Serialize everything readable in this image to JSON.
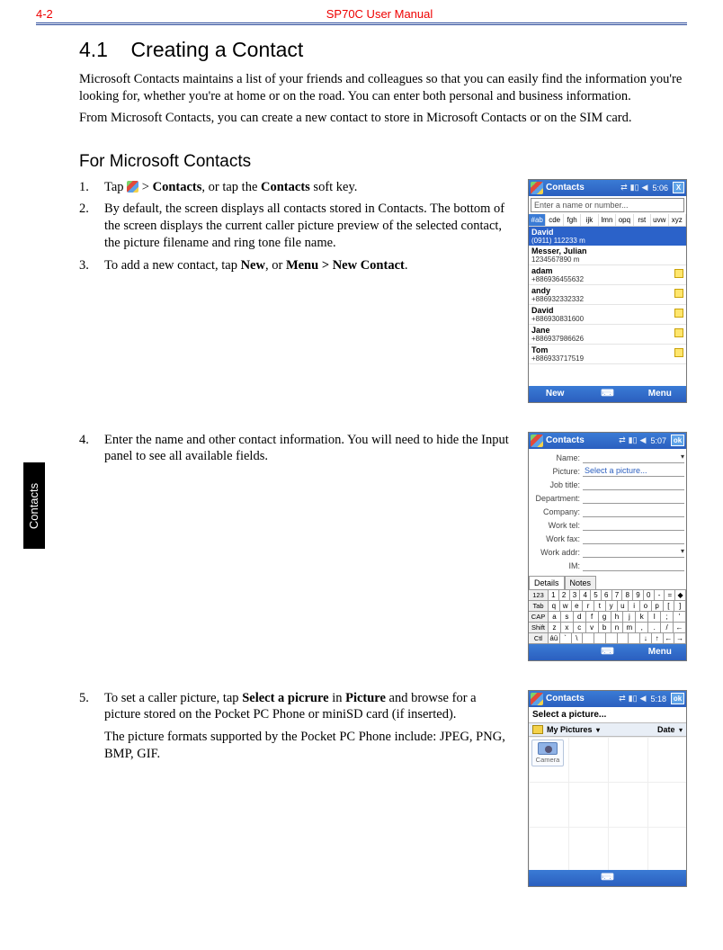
{
  "header": {
    "page_number": "4-2",
    "manual_title": "SP70C User Manual"
  },
  "side_tab": "Contacts",
  "section": {
    "number": "4.1",
    "title": "Creating a Contact"
  },
  "intro_paragraphs": [
    "Microsoft Contacts maintains a list of your friends and colleagues so that you can easily find the information you're looking for, whether you're at home or on the road. You can enter both personal and business information.",
    "From Microsoft Contacts, you can create a new contact to store in Microsoft Contacts or on the SIM card."
  ],
  "subsection_title": "For Microsoft Contacts",
  "steps": {
    "s1": {
      "num": "1.",
      "pre": "Tap ",
      "link": "Contacts",
      "mid": ", or tap the ",
      "link2": "Contacts",
      "post": " soft key.",
      "gt": " > "
    },
    "s2": {
      "num": "2.",
      "text": "By default, the screen displays all contacts stored in Contacts. The bottom of the screen displays the current caller picture preview of the selected contact, the picture filename and ring tone file name."
    },
    "s3": {
      "num": "3.",
      "pre": "To add a new contact, tap ",
      "b1": "New",
      "mid": ", or ",
      "b2": "Menu > New Contact",
      "post": "."
    },
    "s4": {
      "num": "4.",
      "text": "Enter the name and other contact information. You will need to hide the Input panel to see all available fields."
    },
    "s5": {
      "num": "5.",
      "pre": "To set a caller picture, tap ",
      "b1": "Select a picrure",
      "mid": " in ",
      "b2": "Picture",
      "post": " and browse for a picture stored on the Pocket PC Phone or miniSD card (if inserted).",
      "extra": "The picture formats supported by the Pocket PC Phone include: JPEG, PNG, BMP, GIF."
    }
  },
  "shot1": {
    "title": "Contacts",
    "clock": "5:06",
    "close": "X",
    "search_placeholder": "Enter a name or number...",
    "alpha": [
      "#ab",
      "cde",
      "fgh",
      "ijk",
      "lmn",
      "opq",
      "rst",
      "uvw",
      "xyz"
    ],
    "selected": {
      "name": "David",
      "detail": "(0911) 112233  m"
    },
    "rows": [
      {
        "name": "Messer, Julian",
        "detail": "1234567890  m",
        "sim": false
      },
      {
        "name": "adam",
        "detail": "+886936455632",
        "sim": true
      },
      {
        "name": "andy",
        "detail": "+886932332332",
        "sim": true
      },
      {
        "name": "David",
        "detail": "+886930831600",
        "sim": true
      },
      {
        "name": "Jane",
        "detail": "+886937986626",
        "sim": true
      },
      {
        "name": "Tom",
        "detail": "+886933717519",
        "sim": true
      }
    ],
    "softkeys": {
      "left": "New",
      "right": "Menu"
    }
  },
  "shot2": {
    "title": "Contacts",
    "clock": "5:07",
    "ok": "ok",
    "fields": [
      {
        "label": "Name:",
        "value": "",
        "dd": true
      },
      {
        "label": "Picture:",
        "value": "Select a picture...",
        "sel": true
      },
      {
        "label": "Job title:",
        "value": ""
      },
      {
        "label": "Department:",
        "value": ""
      },
      {
        "label": "Company:",
        "value": ""
      },
      {
        "label": "Work tel:",
        "value": ""
      },
      {
        "label": "Work fax:",
        "value": ""
      },
      {
        "label": "Work addr:",
        "value": "",
        "dd": true
      },
      {
        "label": "IM:",
        "value": ""
      }
    ],
    "tabs": [
      "Details",
      "Notes"
    ],
    "kbd": {
      "r1": [
        "123",
        "1",
        "2",
        "3",
        "4",
        "5",
        "6",
        "7",
        "8",
        "9",
        "0",
        "-",
        "=",
        "◆"
      ],
      "r2": [
        "Tab",
        "q",
        "w",
        "e",
        "r",
        "t",
        "y",
        "u",
        "i",
        "o",
        "p",
        "[",
        "]"
      ],
      "r3": [
        "CAP",
        "a",
        "s",
        "d",
        "f",
        "g",
        "h",
        "j",
        "k",
        "l",
        ";",
        "'"
      ],
      "r4": [
        "Shift",
        "z",
        "x",
        "c",
        "v",
        "b",
        "n",
        "m",
        ",",
        ".",
        "/",
        "←"
      ],
      "r5": [
        "Ctl",
        "áü",
        "`",
        "\\",
        "",
        "",
        "",
        "",
        "",
        "↓",
        "↑",
        "←",
        "→"
      ]
    },
    "softkeys": {
      "left": "",
      "right": "Menu"
    }
  },
  "shot3": {
    "title": "Contacts",
    "clock": "5:18",
    "ok": "ok",
    "subtitle": "Select a picture...",
    "folder": "My Pictures",
    "sort": "Date",
    "camera": "Camera",
    "softkeys": {
      "left": "",
      "right": ""
    }
  }
}
